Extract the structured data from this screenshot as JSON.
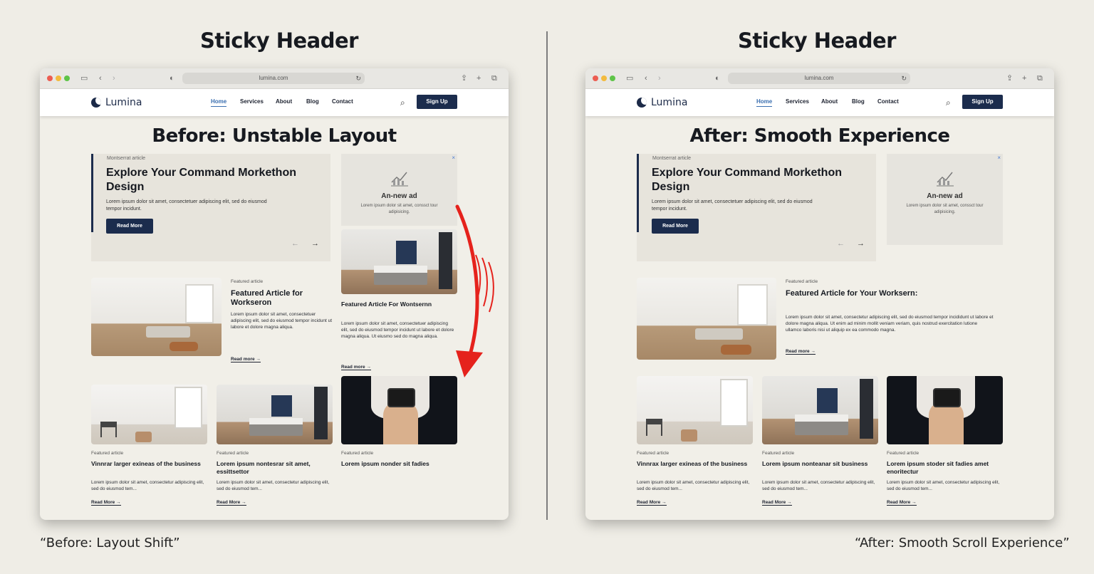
{
  "page": {
    "left_panel_title": "Sticky Header",
    "right_panel_title": "Sticky Header",
    "left_caption": "“Before: Layout Shift”",
    "right_caption": "“After: Smooth Scroll Experience”"
  },
  "browser": {
    "url": "lumina.com",
    "traffic_lights": [
      "#ec5d52",
      "#f3bb3e",
      "#5ec448"
    ]
  },
  "site": {
    "logo": "Lumina",
    "nav": [
      "Home",
      "Services",
      "About",
      "Blog",
      "Contact"
    ],
    "signup": "Sign Up",
    "brand_color": "#1b2c4d",
    "active_nav_color": "#3b6fb0"
  },
  "before": {
    "overlay_title": "Before: Unstable Layout",
    "hero": {
      "eyebrow": "Montserrat article",
      "title": "Explore Your Command Morkethon Design",
      "body": "Lorem ipsum dolor sit amet, consectetuer adipiscing elit, sed do eiusmod tempor incidunt.",
      "button": "Read More",
      "prev": "←",
      "next": "→"
    },
    "ad": {
      "close": "×",
      "title": "An-new ad",
      "body": "Lorem ipsum dolor sit amet, conssct tour adipisicing."
    },
    "featured": {
      "tag": "Featured article",
      "title": "Featured Article for Workseron",
      "body": "Lorem ipsum dolor sit amet, consectetuer adipiscing elit, sed do eiusmod tempor incidunt ut labore et dolore magna aliqua.",
      "link": "Read more →"
    },
    "shifted": {
      "title": "Featured Article For Wontsernn",
      "body": "Lorem ipsum dolor sit amet, consectetuer adipiscing elit, sed do eiusmod tempor incidunt ut labore et dolore magna aliqua. Ut eiusmo sed do magna aliqua.",
      "link": "Read more →"
    },
    "cards": [
      {
        "tag": "Featured article",
        "title": "Vinnrar larger exineas of the business",
        "body": "Lorem ipsum dolor sit amet, consectetur adipiscing elit, sed do eiusmod tem...",
        "link": "Read More →"
      },
      {
        "tag": "Featured article",
        "title": "Lorem ipsum nontesrar sit amet, essittsettor",
        "body": "Lorem ipsum dolor sit amet, consectetur adipiscing elit, sed do eiusmod tem...",
        "link": "Read More →"
      },
      {
        "tag": "Featured article",
        "title": "Lorem ipsum nonder sit fadies"
      }
    ],
    "arrow_color": "#e5221c"
  },
  "after": {
    "overlay_title": "After: Smooth Experience",
    "hero": {
      "eyebrow": "Montserrat article",
      "title": "Explore Your Command Morkethon Design",
      "body": "Lorem ipsum dolor sit amet, consectetuer adipiscing elit, sed do eiusmod tempor incidunt.",
      "button": "Read More",
      "prev": "←",
      "next": "→"
    },
    "ad": {
      "close": "×",
      "title": "An-new ad",
      "body": "Lorem ipsum dolor sit amet, conssct tour adipisicing."
    },
    "featured": {
      "tag": "Featured article",
      "title": "Featured Article for Your Worksern:",
      "body": "Lorem ipsum dolor sit amet, consectetur adipiscing elit, sed do eiusmod tempor incididunt ut labore et dolore magna aliqua. Ut enim ad minim mollit veniam veriam, quis nostrud exercitation lutione ullamco laboris nisi ut aliquip ex ea commodo magna.",
      "link": "Read more →"
    },
    "cards": [
      {
        "tag": "Featured article",
        "title": "Vinnrax larger exineas of the business",
        "body": "Lorem ipsum dolor sit amet, consectetur adipiscing elit, sed do eiusmod tem...",
        "link": "Read More →"
      },
      {
        "tag": "Featured article",
        "title": "Lorem ipsum nonteanar sit business",
        "body": "Lorem ipsum dolor sit amet, consectetur adipiscing elit, sed do eiusmod tem...",
        "link": "Read More →"
      },
      {
        "tag": "Featured article",
        "title": "Lorem ipsum stoder sit fadies amet enoritectur",
        "body": "Lorem ipsum dolor sit amet, consectetur adipiscing elit, sed do eiusmod tem...",
        "link": "Read More →"
      }
    ]
  }
}
